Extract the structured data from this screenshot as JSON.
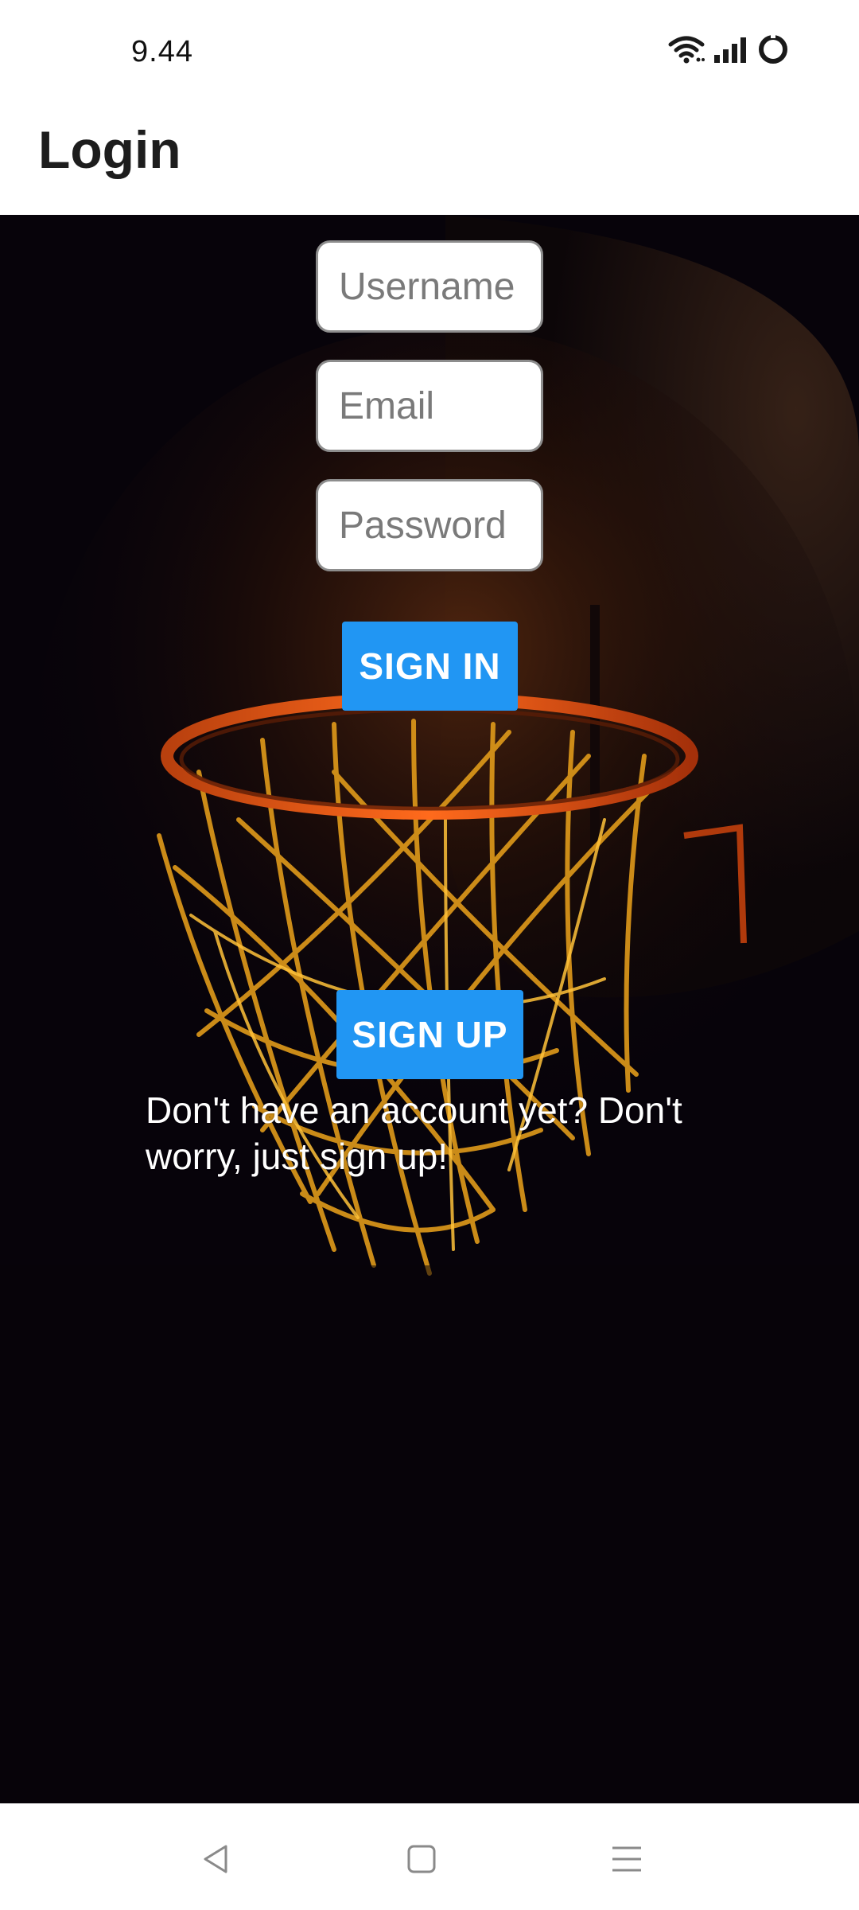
{
  "status_bar": {
    "time": "9.44",
    "icons": [
      "wifi-icon",
      "signal-icon",
      "battery-ring-icon"
    ]
  },
  "app_bar": {
    "title": "Login"
  },
  "form": {
    "username_placeholder": "Username",
    "username_value": "",
    "email_placeholder": "Email",
    "email_value": "",
    "password_placeholder": "Password",
    "password_value": "",
    "sign_in_label": "SIGN IN"
  },
  "signup": {
    "prompt": "Don't have an account yet? Don't worry, just sign up!",
    "sign_up_label": "SIGN UP"
  },
  "background": {
    "subject": "basketball-hoop-image"
  },
  "nav_bar": {
    "icons": [
      "back-icon",
      "home-icon",
      "menu-icon"
    ]
  },
  "colors": {
    "accent": "#2196f3",
    "content_background": "#07030a",
    "title_text": "#1d1d1d"
  }
}
